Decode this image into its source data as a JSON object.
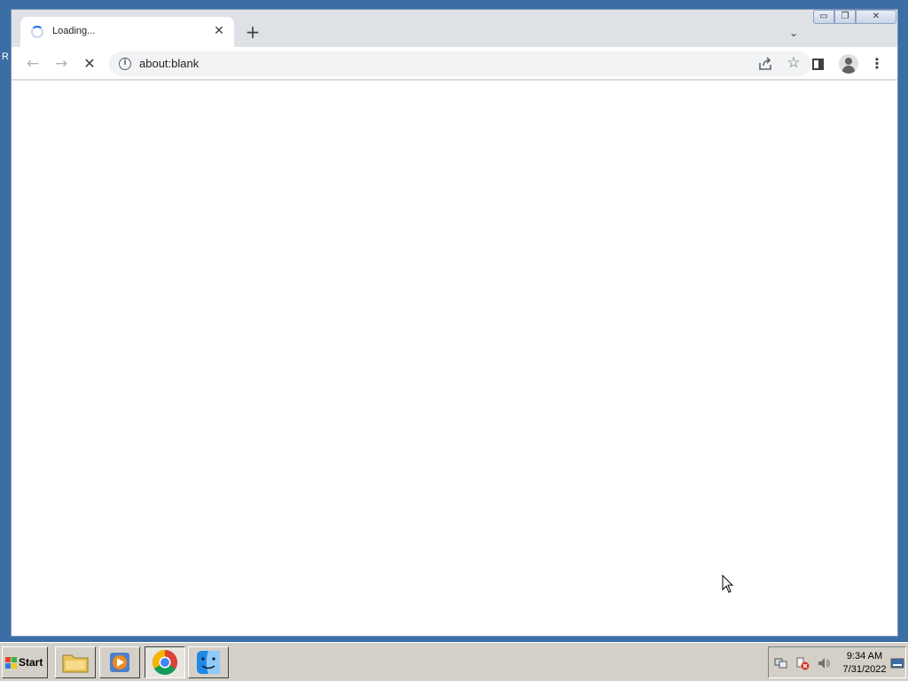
{
  "desktop": {
    "stray_text": "R"
  },
  "browser": {
    "tab": {
      "title": "Loading...",
      "close_glyph": "✕"
    },
    "new_tab_glyph": "+",
    "tab_search_glyph": "⌄",
    "window_controls": {
      "minimize": "▭",
      "maximize": "❐",
      "close": "✕"
    },
    "toolbar": {
      "back_glyph": "←",
      "forward_glyph": "→",
      "stop_glyph": "✕",
      "url": "about:blank",
      "info_glyph": "i",
      "star_glyph": "☆",
      "menu_glyph": "⋮"
    }
  },
  "taskbar": {
    "start_label": "Start",
    "apps": [
      "file-explorer",
      "media-player",
      "chrome",
      "finder"
    ],
    "active_app": "chrome",
    "clock": {
      "time": "9:34 AM",
      "date": "7/31/2022"
    }
  },
  "colors": {
    "desktop": "#3a6ea5",
    "chrome_frame": "#dee1e6",
    "accent": "#1a73e8"
  }
}
